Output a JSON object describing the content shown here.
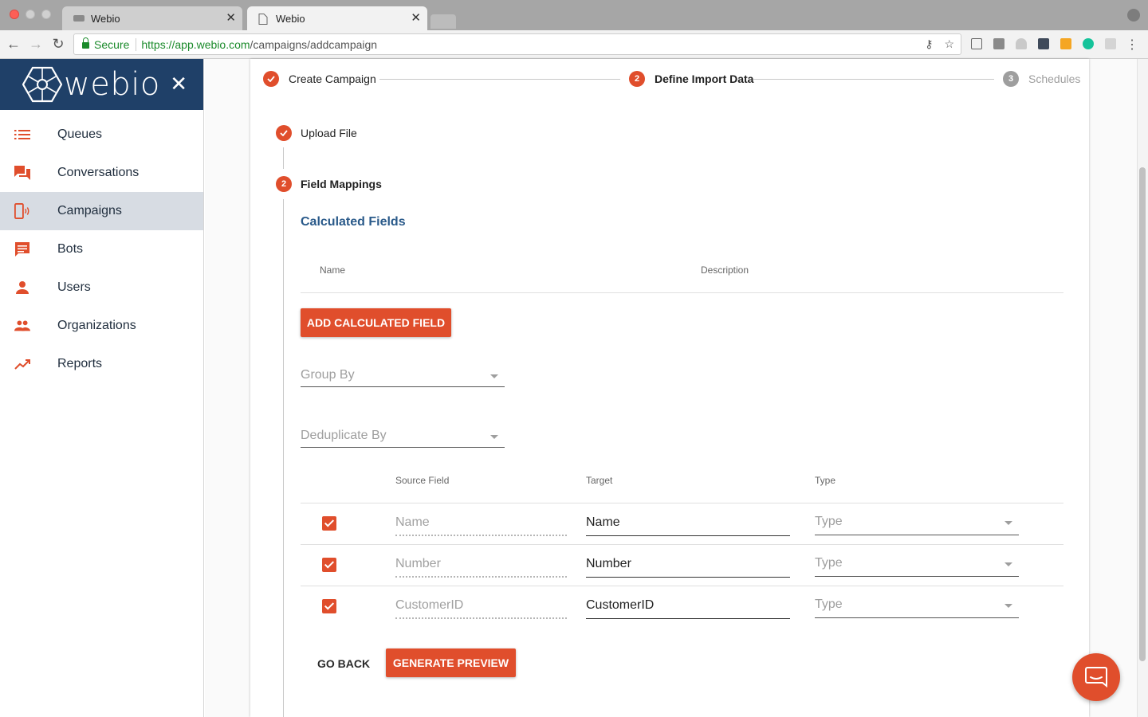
{
  "browser": {
    "tabs": [
      {
        "title": "Webio"
      },
      {
        "title": "Webio"
      }
    ],
    "secure_label": "Secure",
    "url_host": "https://app.webio.com",
    "url_path": "/campaigns/addcampaign"
  },
  "sidebar": {
    "brand": "webio",
    "items": [
      {
        "label": "Queues",
        "icon": "list-icon"
      },
      {
        "label": "Conversations",
        "icon": "chat-icon"
      },
      {
        "label": "Campaigns",
        "icon": "phone-broadcast-icon",
        "active": true
      },
      {
        "label": "Bots",
        "icon": "message-icon"
      },
      {
        "label": "Users",
        "icon": "person-icon"
      },
      {
        "label": "Organizations",
        "icon": "group-icon"
      },
      {
        "label": "Reports",
        "icon": "trending-icon"
      }
    ]
  },
  "stepper": {
    "steps": [
      {
        "label": "Create Campaign",
        "state": "done"
      },
      {
        "number": "2",
        "label": "Define Import Data",
        "state": "active"
      },
      {
        "number": "3",
        "label": "Schedules",
        "state": "pending"
      }
    ]
  },
  "substeps": [
    {
      "label": "Upload File",
      "state": "done"
    },
    {
      "number": "2",
      "label": "Field Mappings",
      "state": "active"
    }
  ],
  "calculated_fields": {
    "title": "Calculated Fields",
    "columns": [
      "Name",
      "Description"
    ],
    "add_button": "ADD CALCULATED FIELD"
  },
  "group_by": {
    "placeholder": "Group By"
  },
  "deduplicate_by": {
    "placeholder": "Deduplicate By"
  },
  "mapping_table": {
    "columns": [
      "Source Field",
      "Target",
      "Type"
    ],
    "rows": [
      {
        "checked": true,
        "source": "Name",
        "target": "Name",
        "type": "Type"
      },
      {
        "checked": true,
        "source": "Number",
        "target": "Number",
        "type": "Type"
      },
      {
        "checked": true,
        "source": "CustomerID",
        "target": "CustomerID",
        "type": "Type"
      }
    ]
  },
  "actions": {
    "back": "GO BACK",
    "generate": "GENERATE PREVIEW"
  },
  "colors": {
    "accent": "#e04e2c",
    "brand_bar": "#1f4068",
    "section_title": "#2a5a8a"
  }
}
